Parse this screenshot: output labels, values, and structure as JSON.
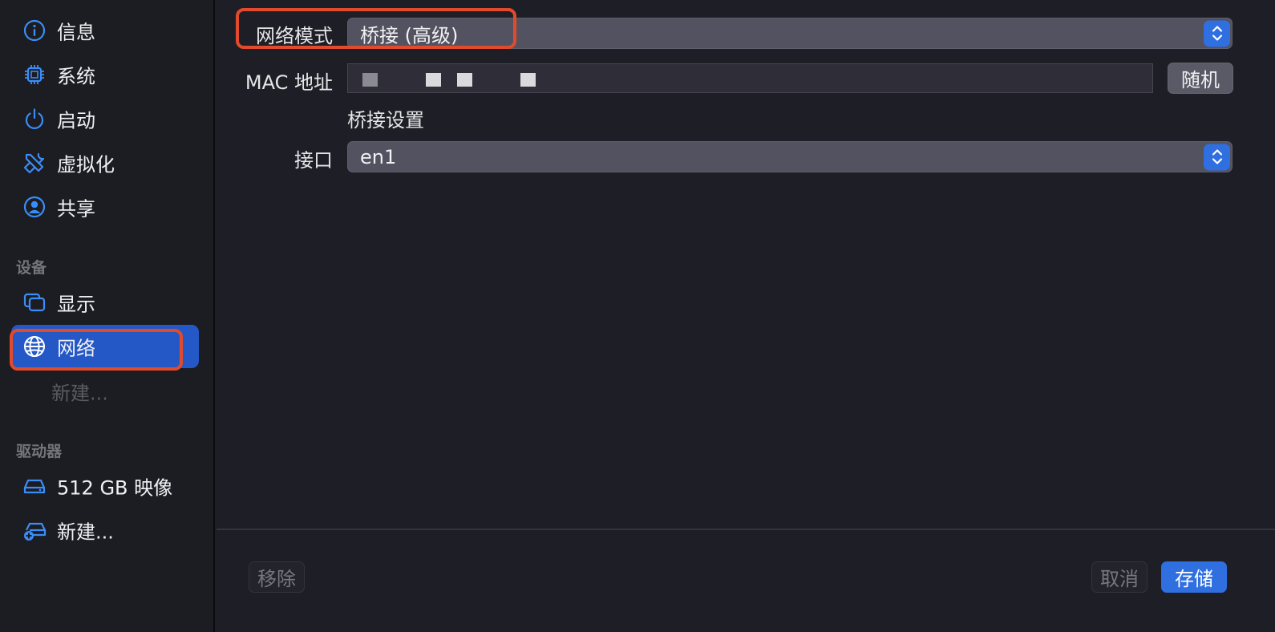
{
  "sidebar": {
    "items": [
      {
        "label": "信息",
        "icon": "info-icon"
      },
      {
        "label": "系统",
        "icon": "cpu-chip-icon"
      },
      {
        "label": "启动",
        "icon": "power-icon"
      },
      {
        "label": "虚拟化",
        "icon": "tools-icon"
      },
      {
        "label": "共享",
        "icon": "person-circle-icon"
      }
    ],
    "devices_heading": "设备",
    "devices": [
      {
        "label": "显示",
        "icon": "display-icon"
      },
      {
        "label": "网络",
        "icon": "globe-icon",
        "selected": true
      },
      {
        "label": "新建...",
        "disabled": true
      }
    ],
    "drives_heading": "驱动器",
    "drives": [
      {
        "label": "512 GB 映像",
        "icon": "drive-icon"
      },
      {
        "label": "新建...",
        "icon": "add-drive-icon"
      }
    ]
  },
  "network": {
    "mode_label": "网络模式",
    "mode_value": "桥接 (高级)",
    "mac_label": "MAC 地址",
    "random_button": "随机",
    "bridge_section_title": "桥接设置",
    "interface_label": "接口",
    "interface_value": "en1"
  },
  "footer": {
    "remove_button": "移除",
    "cancel_button": "取消",
    "save_button": "存储"
  },
  "colors": {
    "accent": "#2f6fe0",
    "selection": "#2458c6",
    "callout": "#e24a2c",
    "icon": "#3a8df5"
  }
}
